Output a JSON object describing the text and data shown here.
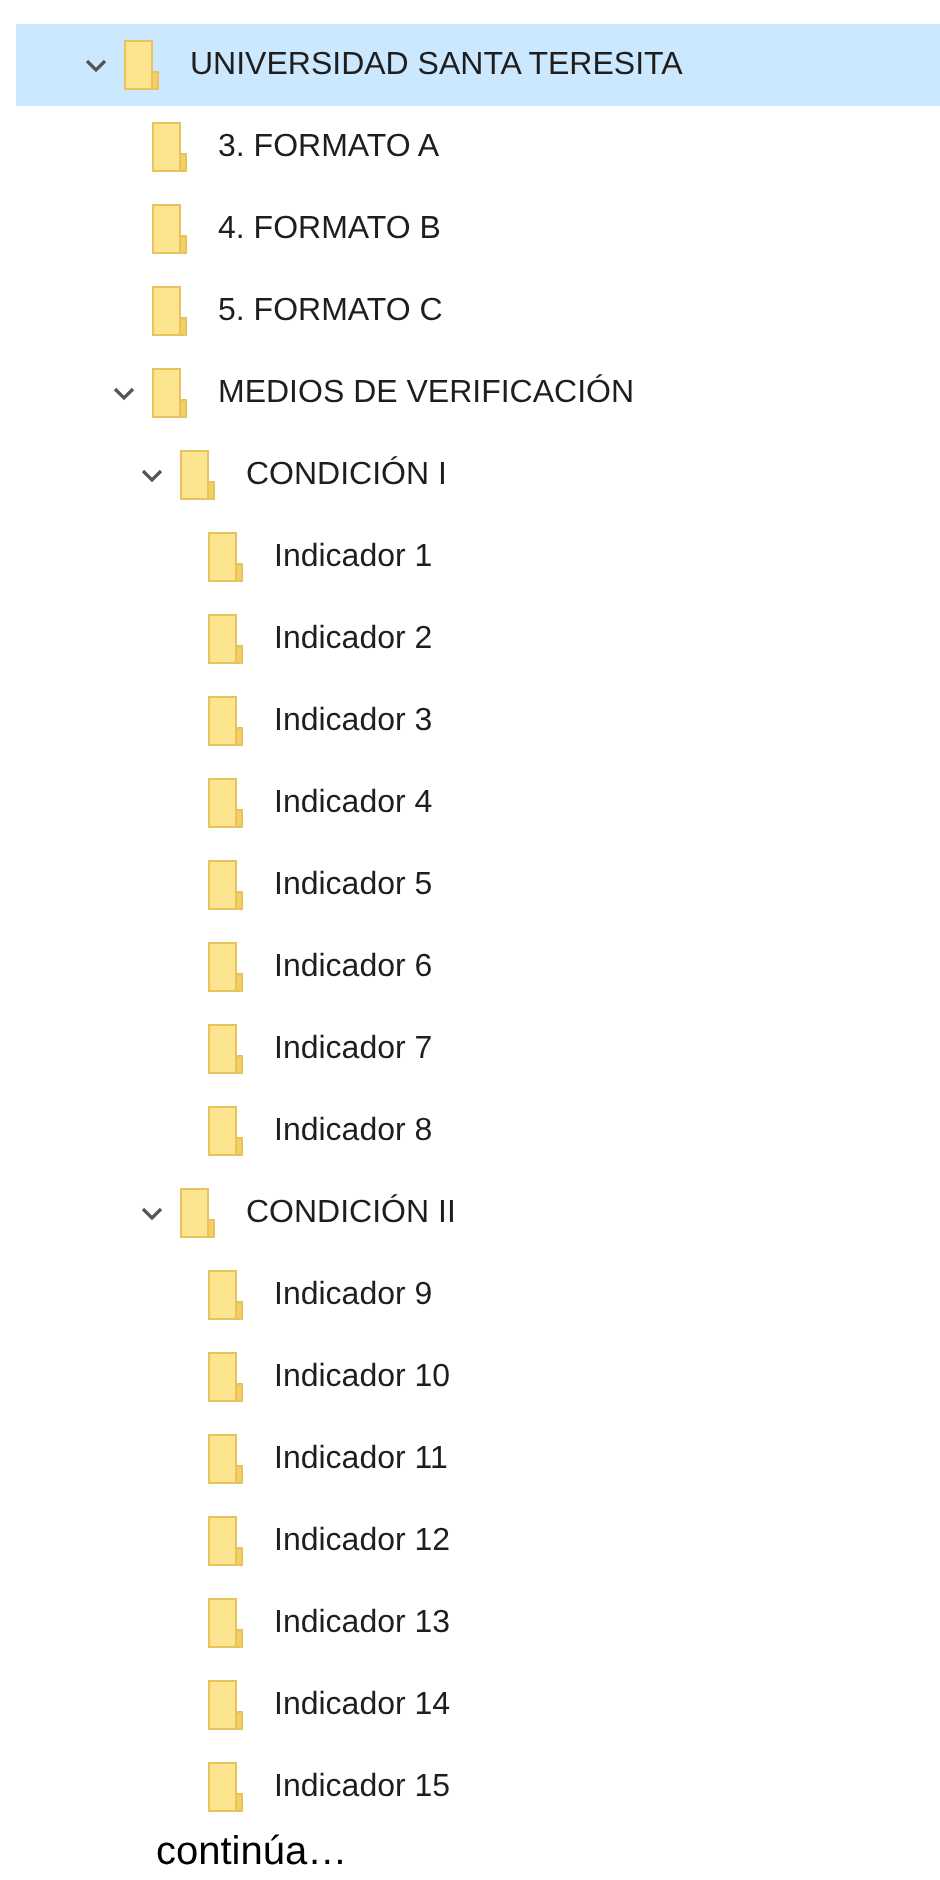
{
  "tree": [
    {
      "label": "UNIVERSIDAD SANTA TERESITA",
      "selected": true,
      "expanded": true,
      "children": [
        {
          "label": "3. FORMATO A",
          "selected": false
        },
        {
          "label": "4. FORMATO B",
          "selected": false
        },
        {
          "label": "5. FORMATO C",
          "selected": false
        },
        {
          "label": "MEDIOS DE VERIFICACIÓN",
          "selected": false,
          "expanded": true,
          "children": [
            {
              "label": "CONDICIÓN I",
              "selected": false,
              "expanded": true,
              "children": [
                {
                  "label": "Indicador 1",
                  "selected": false
                },
                {
                  "label": "Indicador 2",
                  "selected": false
                },
                {
                  "label": "Indicador 3",
                  "selected": false
                },
                {
                  "label": "Indicador 4",
                  "selected": false
                },
                {
                  "label": "Indicador 5",
                  "selected": false
                },
                {
                  "label": "Indicador 6",
                  "selected": false
                },
                {
                  "label": "Indicador 7",
                  "selected": false
                },
                {
                  "label": "Indicador 8",
                  "selected": false
                }
              ]
            },
            {
              "label": "CONDICIÓN II",
              "selected": false,
              "expanded": true,
              "children": [
                {
                  "label": "Indicador 9",
                  "selected": false
                },
                {
                  "label": "Indicador 10",
                  "selected": false
                },
                {
                  "label": "Indicador 11",
                  "selected": false
                },
                {
                  "label": "Indicador 12",
                  "selected": false
                },
                {
                  "label": "Indicador 13",
                  "selected": false
                },
                {
                  "label": "Indicador 14",
                  "selected": false
                },
                {
                  "label": "Indicador 15",
                  "selected": false
                }
              ]
            }
          ]
        }
      ]
    }
  ],
  "footer": "continúa…"
}
